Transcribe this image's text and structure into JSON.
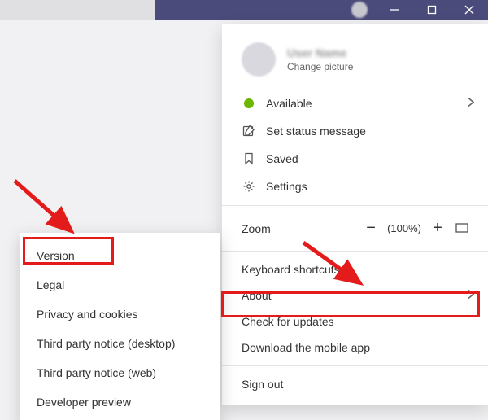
{
  "profile": {
    "name": "User Name",
    "change_picture": "Change picture"
  },
  "menu": {
    "available": "Available",
    "set_status": "Set status message",
    "saved": "Saved",
    "settings": "Settings",
    "zoom_label": "Zoom",
    "zoom_pct": "(100%)",
    "keyboard_shortcuts": "Keyboard shortcuts",
    "about": "About",
    "check_updates": "Check for updates",
    "download_app": "Download the mobile app",
    "sign_out": "Sign out"
  },
  "submenu": {
    "version": "Version",
    "legal": "Legal",
    "privacy": "Privacy and cookies",
    "tpn_desktop": "Third party notice (desktop)",
    "tpn_web": "Third party notice (web)",
    "dev_preview": "Developer preview"
  }
}
